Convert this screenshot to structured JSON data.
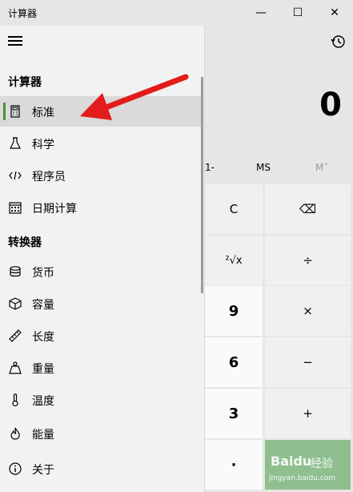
{
  "window": {
    "title": "计算器",
    "min_label": "—",
    "max_label": "☐",
    "close_label": "✕"
  },
  "nav": {
    "calculator_header": "计算器",
    "converter_header": "转换器",
    "calculator_items": [
      {
        "label": "标准",
        "icon": "calculator-icon",
        "selected": true
      },
      {
        "label": "科学",
        "icon": "flask-icon"
      },
      {
        "label": "程序员",
        "icon": "code-icon"
      },
      {
        "label": "日期计算",
        "icon": "calendar-icon"
      }
    ],
    "converter_items": [
      {
        "label": "货币",
        "icon": "coins-icon"
      },
      {
        "label": "容量",
        "icon": "cube-icon"
      },
      {
        "label": "长度",
        "icon": "ruler-icon"
      },
      {
        "label": "重量",
        "icon": "weight-icon"
      },
      {
        "label": "温度",
        "icon": "thermometer-icon"
      },
      {
        "label": "能量",
        "icon": "flame-icon"
      }
    ],
    "about": {
      "label": "关于",
      "icon": "info-icon"
    }
  },
  "calculator": {
    "display": "0",
    "memory": {
      "partial": "1-",
      "ms": "MS",
      "mv": "M˅"
    },
    "keys": {
      "c": "C",
      "backspace": "⌫",
      "root": "²√x",
      "divide": "÷",
      "nine": "9",
      "multiply": "×",
      "six": "6",
      "minus": "−",
      "three": "3",
      "plus": "+",
      "dot": "·"
    }
  },
  "watermark": {
    "brand": "Baidu",
    "text": "经验",
    "url": "jingyan.baidu.com"
  }
}
